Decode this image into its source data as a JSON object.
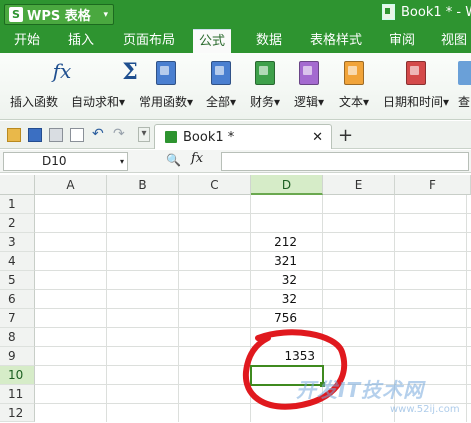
{
  "titlebar": {
    "app_name": "WPS 表格",
    "app_logo": "S",
    "doc_title": "Book1 * - W"
  },
  "menu": {
    "tabs": [
      "开始",
      "插入",
      "页面布局",
      "公式",
      "数据",
      "表格样式",
      "审阅",
      "视图"
    ],
    "active": "公式"
  },
  "ribbon": {
    "buttons": [
      {
        "label": "插入函数",
        "icon": "fx-icon"
      },
      {
        "label": "自动求和",
        "icon": "sigma-icon",
        "dropdown": "▾"
      },
      {
        "label": "常用函数",
        "icon": "blue-book-icon",
        "dropdown": "▾"
      },
      {
        "label": "全部",
        "icon": "blue-book-icon",
        "dropdown": "▾"
      },
      {
        "label": "财务",
        "icon": "green-book-icon",
        "dropdown": "▾"
      },
      {
        "label": "逻辑",
        "icon": "purple-book-icon",
        "dropdown": "▾"
      },
      {
        "label": "文本",
        "icon": "orange-book-icon",
        "dropdown": "▾"
      },
      {
        "label": "日期和时间",
        "icon": "red-book-icon",
        "dropdown": "▾"
      },
      {
        "label": "查",
        "icon": "partial-icon"
      }
    ],
    "colors": {
      "blue": "#4a7fd0",
      "green": "#3ea04a",
      "purple": "#a46ad0",
      "orange": "#f1a43a",
      "red": "#d44a4a"
    }
  },
  "doc_tab": {
    "name": "Book1 *",
    "close": "✕",
    "new": "+"
  },
  "formula_bar": {
    "cell_ref": "D10",
    "fx": "fx",
    "zoom_icon": "🔍",
    "formula": ""
  },
  "sheet": {
    "columns": [
      "A",
      "B",
      "C",
      "D",
      "E",
      "F"
    ],
    "selected_column": "D",
    "rows": [
      "1",
      "2",
      "3",
      "4",
      "5",
      "6",
      "7",
      "8",
      "9",
      "10",
      "11",
      "12"
    ],
    "selected_row": "10",
    "d_values": {
      "3": "212",
      "4": "321",
      "5": "32",
      "6": "32",
      "7": "756",
      "9": "1353"
    }
  },
  "watermark": {
    "main": "开发IT技术网",
    "sub": "www.52ij.com"
  },
  "annotation_color": "#e0191e"
}
